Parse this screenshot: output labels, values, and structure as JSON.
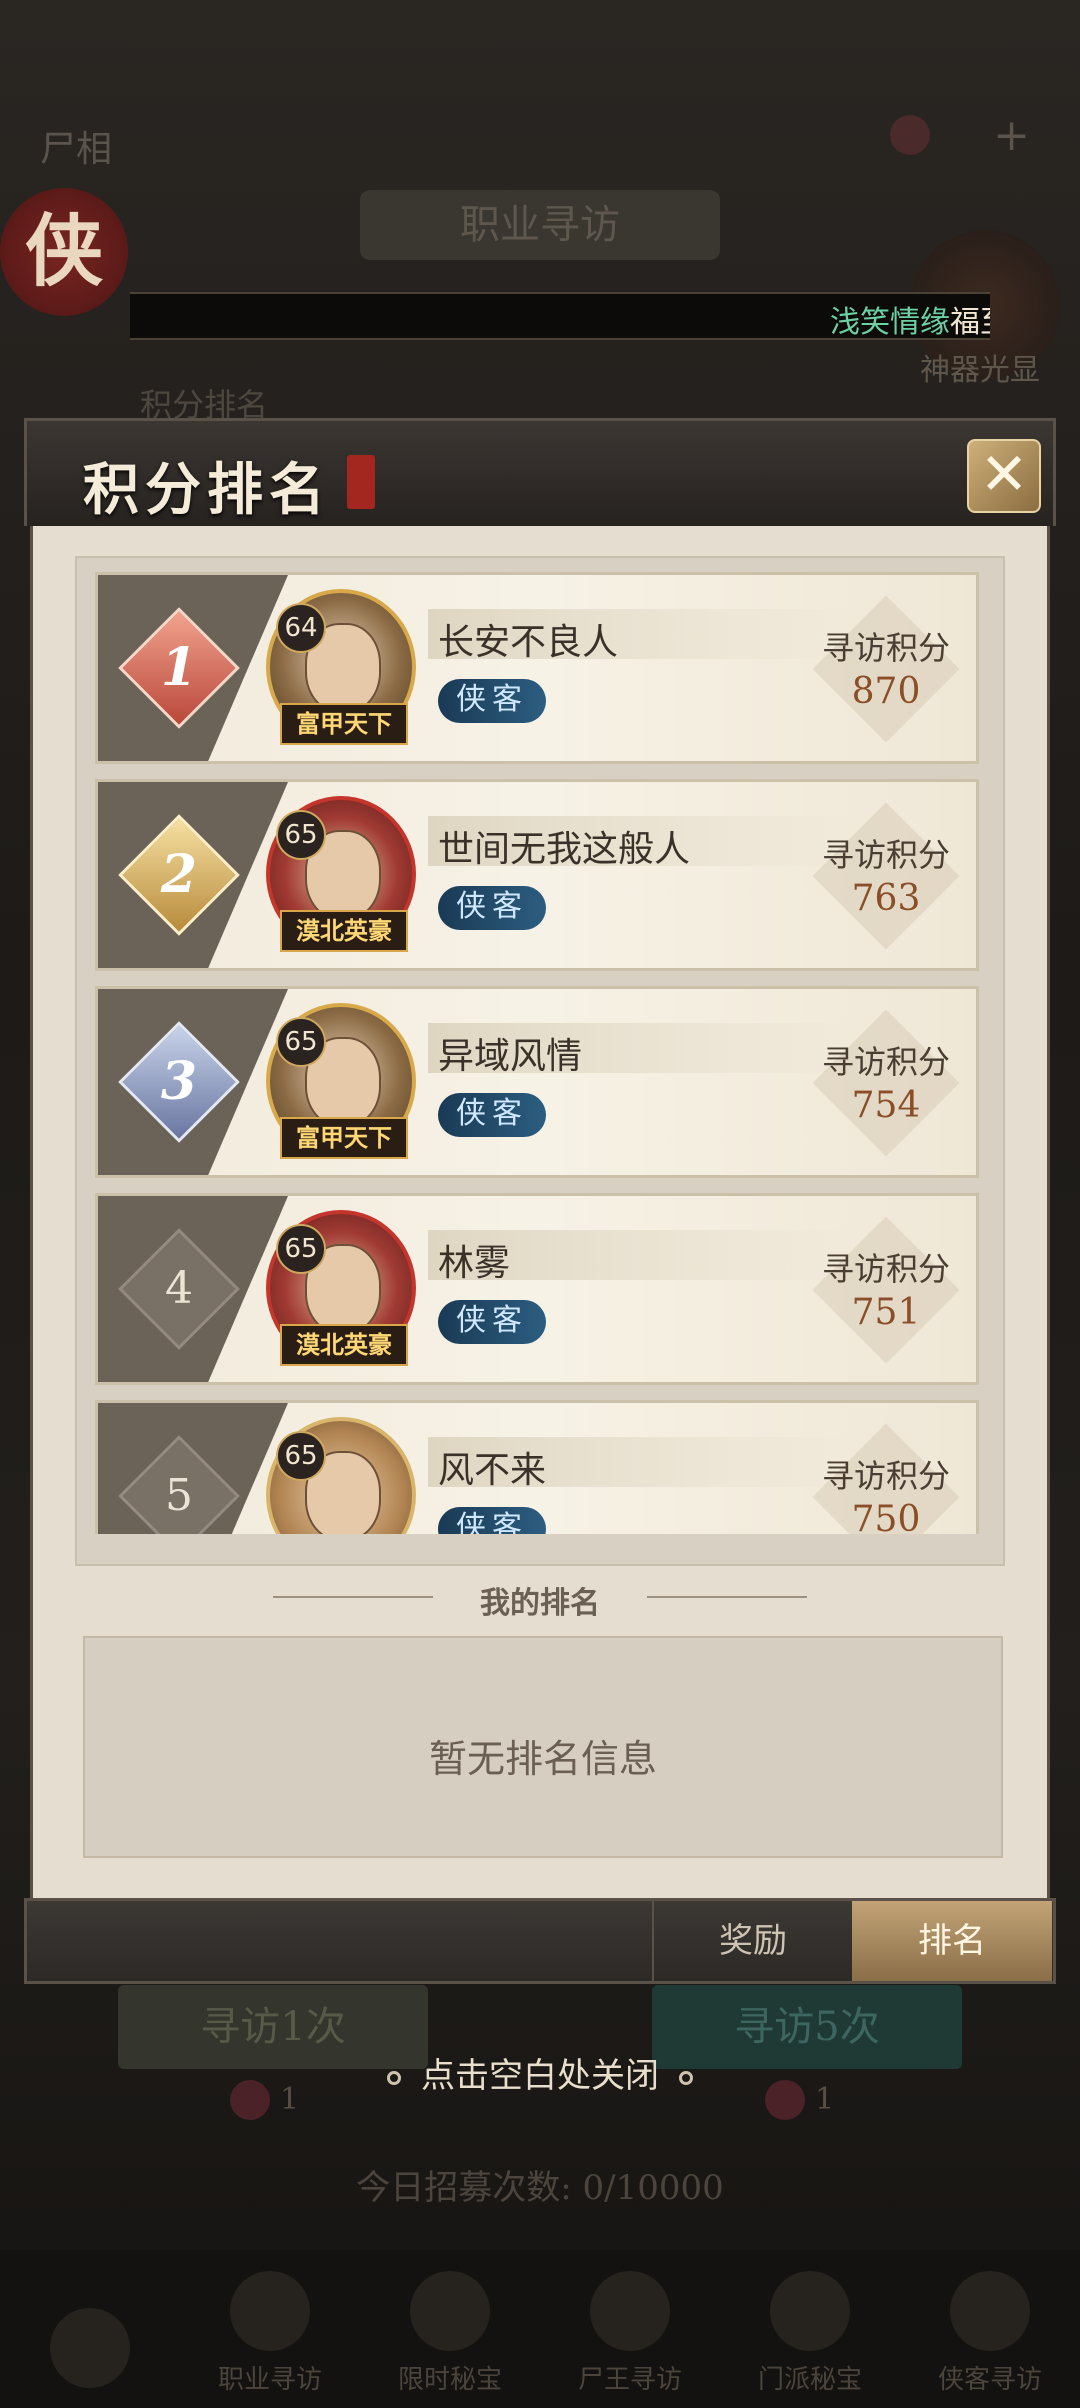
{
  "background": {
    "top_title": "尸相",
    "banner": "职业寻访",
    "seal_char": "侠",
    "marquee": {
      "name": "浅笑情缘",
      "message": "福至"
    },
    "sub_label": "积分排名",
    "right_badge_label": "神器光显",
    "buttons": {
      "left": "寻访1次",
      "right": "寻访5次"
    },
    "token_counts": [
      "1",
      "1"
    ],
    "daily_count": "今日招募次数: 0/10000",
    "nav": [
      "",
      "职业寻访",
      "限时秘宝",
      "尸王寻访",
      "门派秘宝",
      "侠客寻访"
    ]
  },
  "modal": {
    "title": "积分排名",
    "close_icon": "close-icon",
    "score_label": "寻访积分",
    "rows": [
      {
        "rank": "1",
        "level": "64",
        "name": "长安不良人",
        "role": "侠客",
        "title": "富甲天下",
        "score": "870"
      },
      {
        "rank": "2",
        "level": "65",
        "name": "世间无我这般人",
        "role": "侠客",
        "title": "漠北英豪",
        "score": "763"
      },
      {
        "rank": "3",
        "level": "65",
        "name": "异域风情",
        "role": "侠客",
        "title": "富甲天下",
        "score": "754"
      },
      {
        "rank": "4",
        "level": "65",
        "name": "林雾",
        "role": "侠客",
        "title": "漠北英豪",
        "score": "751"
      },
      {
        "rank": "5",
        "level": "65",
        "name": "风不来",
        "role": "侠客",
        "title": "",
        "score": "750"
      }
    ],
    "my_rank_title": "我的排名",
    "my_rank_empty": "暂无排名信息",
    "tabs": {
      "reward": "奖励",
      "rank": "排名"
    }
  },
  "hint": "点击空白处关闭"
}
